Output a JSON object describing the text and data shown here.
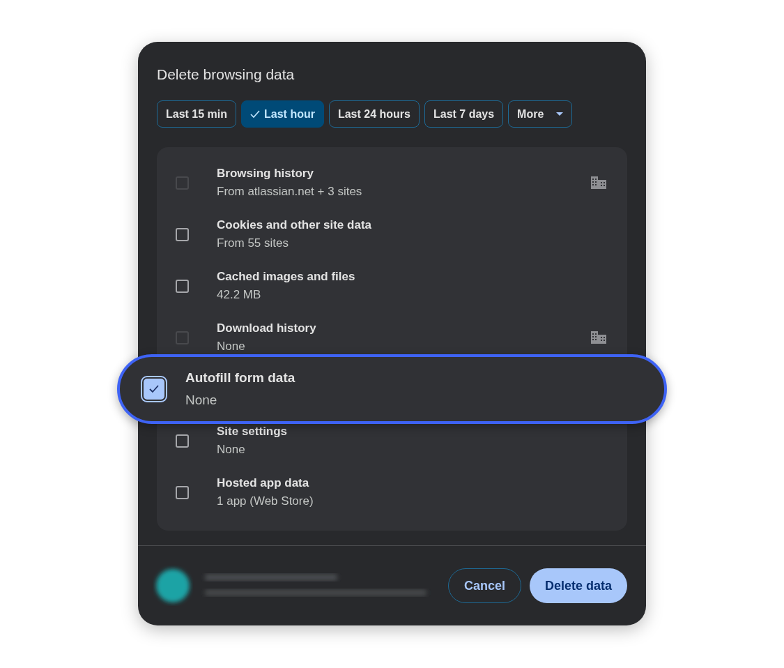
{
  "dialog": {
    "title": "Delete browsing data"
  },
  "time_ranges": [
    {
      "label": "Last 15 min",
      "selected": false,
      "kind": "chip"
    },
    {
      "label": "Last hour",
      "selected": true,
      "kind": "chip"
    },
    {
      "label": "Last 24 hours",
      "selected": false,
      "kind": "chip"
    },
    {
      "label": "Last 7 days",
      "selected": false,
      "kind": "chip"
    },
    {
      "label": "More",
      "selected": false,
      "kind": "dropdown"
    }
  ],
  "items": [
    {
      "title": "Browsing history",
      "detail": "From atlassian.net + 3 sites",
      "checked": false,
      "disabled": true,
      "highlighted": false
    },
    {
      "title": "Cookies and other site data",
      "detail": "From 55 sites",
      "checked": false,
      "disabled": false,
      "highlighted": false
    },
    {
      "title": "Cached images and files",
      "detail": "42.2 MB",
      "checked": false,
      "disabled": false,
      "highlighted": false
    },
    {
      "title": "Download history",
      "detail": "None",
      "checked": false,
      "disabled": true,
      "highlighted": false
    },
    {
      "title": "Autofill form data",
      "detail": "None",
      "checked": true,
      "disabled": false,
      "highlighted": true
    },
    {
      "title": "Site settings",
      "detail": "None",
      "checked": false,
      "disabled": false,
      "highlighted": false
    },
    {
      "title": "Hosted app data",
      "detail": "1 app (Web Store)",
      "checked": false,
      "disabled": false,
      "highlighted": false
    }
  ],
  "buttons": [
    {
      "label": "Cancel",
      "kind": "secondary"
    },
    {
      "label": "Delete data",
      "kind": "primary"
    }
  ]
}
